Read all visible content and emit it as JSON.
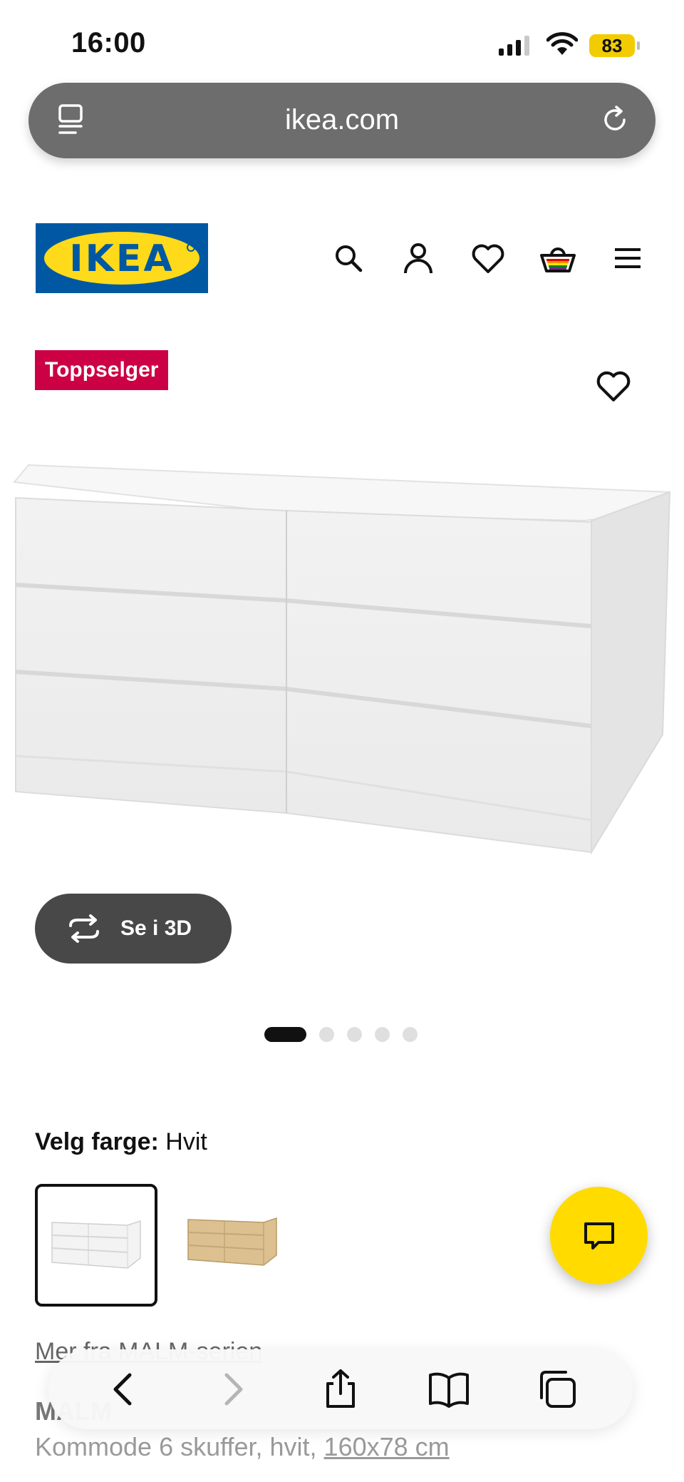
{
  "status_bar": {
    "time": "16:00",
    "battery": "83"
  },
  "browser": {
    "url": "ikea.com"
  },
  "header": {
    "logo_text": "IKEA",
    "icons": [
      "search-icon",
      "account-icon",
      "favorites-icon",
      "basket-icon",
      "menu-icon"
    ]
  },
  "product": {
    "badge": "Toppselger",
    "view_3d_label": "Se i 3D",
    "gallery": {
      "count": 5,
      "active_index": 0
    },
    "color_label": "Velg farge:",
    "color_value": "Hvit",
    "swatches": [
      {
        "name": "white",
        "selected": true
      },
      {
        "name": "oak",
        "selected": false
      }
    ],
    "series_link": "Mer fra MALM-serien",
    "name": "MALM",
    "description": "Kommode 6 skuffer, hvit,",
    "dimensions": "160x78 cm"
  },
  "colors": {
    "ikea_blue": "#0058a3",
    "ikea_yellow": "#ffda1a",
    "badge_red": "#cc0044",
    "url_bar_gray": "#6d6d6d",
    "chat_yellow": "#ffdb00"
  }
}
